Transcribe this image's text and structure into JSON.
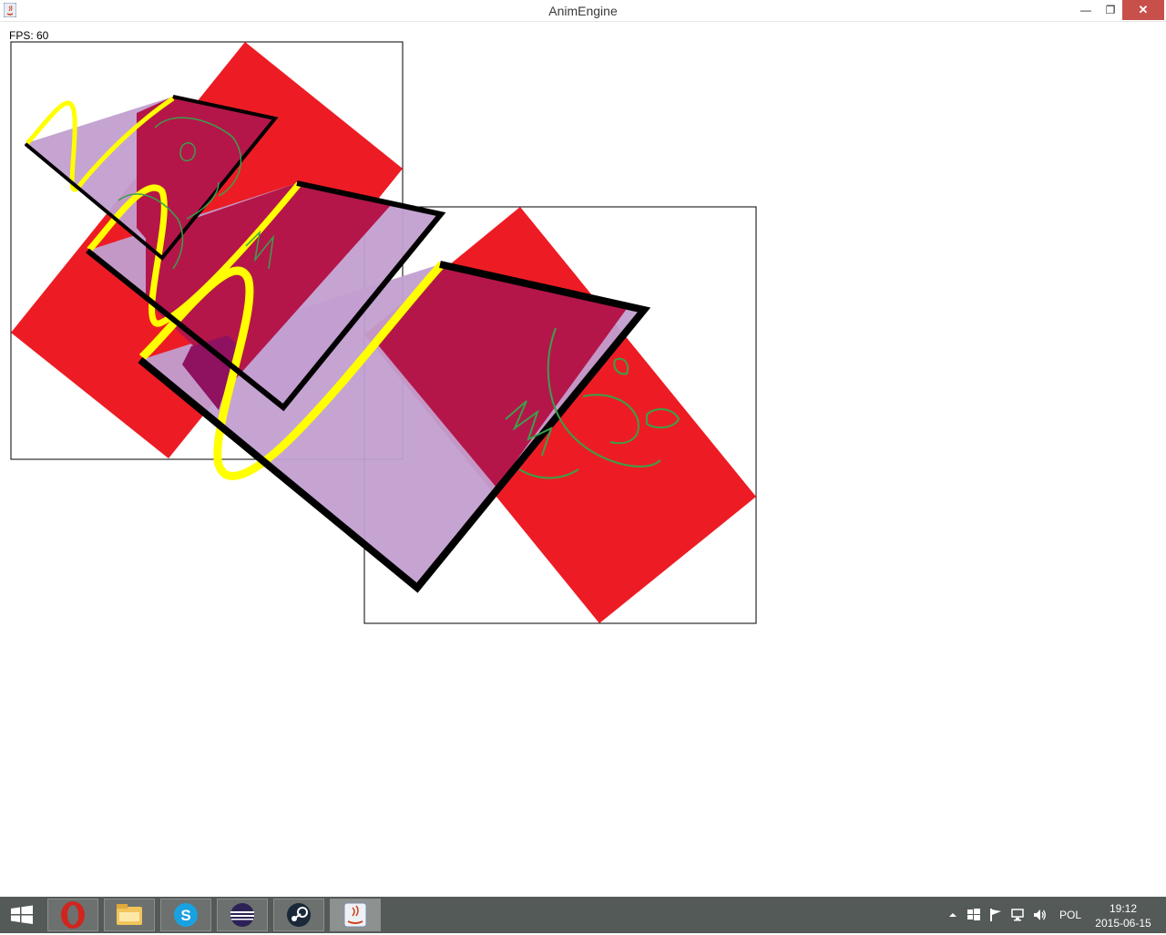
{
  "window": {
    "title": "AnimEngine",
    "minimize_glyph": "—",
    "restore_glyph": "❐",
    "close_glyph": "✕"
  },
  "canvas": {
    "fps_label": "FPS: 60"
  },
  "taskbar": {
    "apps": [
      "opera-icon",
      "file-explorer-icon",
      "skype-icon",
      "eclipse-icon",
      "steam-icon",
      "java-icon"
    ],
    "tray_icons": [
      "show-hidden-icons-chevron",
      "windows-flag-icon",
      "action-flag-icon",
      "network-icon",
      "volume-icon"
    ],
    "language": "POL",
    "time": "19:12",
    "date": "2015-06-15"
  },
  "colors": {
    "red": "#ed1c24",
    "lavender": "#c29fd0",
    "overlap": "#b4164a",
    "yellow": "#ffff00",
    "green": "#3aa04a",
    "taskbar": "#545a57"
  }
}
